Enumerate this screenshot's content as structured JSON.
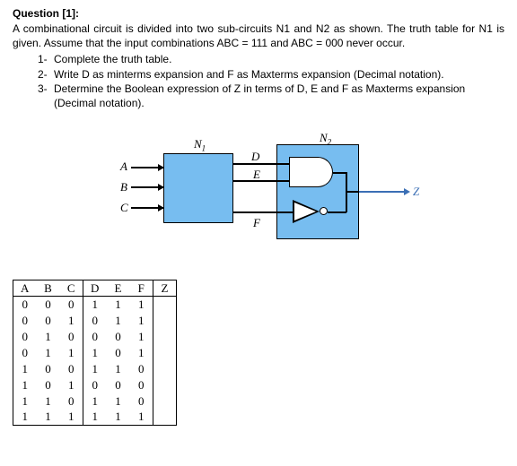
{
  "heading": "Question [1]:",
  "prompt_line": "A combinational circuit is divided into two sub-circuits N1 and N2 as shown.  The truth table for N1 is given.  Assume that the input combinations ABC = 111 and   ABC = 000 never occur.",
  "tasks": {
    "n1": "1-",
    "t1": "Complete the truth table.",
    "n2": "2-",
    "t2": "Write D as minterms expansion and F as Maxterms expansion (Decimal notation).",
    "n3": "3-",
    "t3": "Determine the Boolean expression of Z in terms of D, E and F as Maxterms expansion",
    "t3b": "(Decimal notation)."
  },
  "labels": {
    "N1a": "N",
    "N1b": "1",
    "N2a": "N",
    "N2b": "2",
    "A": "A",
    "B": "B",
    "C": "C",
    "D": "D",
    "E": "E",
    "F": "F",
    "Z": "Z"
  },
  "truth": {
    "headers": [
      "A",
      "B",
      "C",
      "D",
      "E",
      "F",
      "Z"
    ],
    "rows": [
      [
        "0",
        "0",
        "0",
        "1",
        "1",
        "1",
        ""
      ],
      [
        "0",
        "0",
        "1",
        "0",
        "1",
        "1",
        ""
      ],
      [
        "0",
        "1",
        "0",
        "0",
        "0",
        "1",
        ""
      ],
      [
        "0",
        "1",
        "1",
        "1",
        "0",
        "1",
        ""
      ],
      [
        "1",
        "0",
        "0",
        "1",
        "1",
        "0",
        ""
      ],
      [
        "1",
        "0",
        "1",
        "0",
        "0",
        "0",
        ""
      ],
      [
        "1",
        "1",
        "0",
        "1",
        "1",
        "0",
        ""
      ],
      [
        "1",
        "1",
        "1",
        "1",
        "1",
        "1",
        ""
      ]
    ]
  }
}
